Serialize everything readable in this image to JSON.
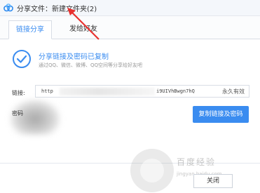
{
  "window": {
    "title": "分享文件：新建文件夹(2)",
    "app_icon": "baidu-netdisk-cloud-icon"
  },
  "tabs": [
    {
      "label": "链接分享",
      "active": true
    },
    {
      "label": "发给好友",
      "active": false
    }
  ],
  "status": {
    "title": "分享链接及密码已复制",
    "subtitle": "通过QQ、微信、微博、QQ空间等分享给好友吧",
    "icon": "check-circle-icon",
    "accent": "#3a8cf0"
  },
  "link": {
    "label": "链接:",
    "value_start": "http",
    "value_end": "i9UIVhBwgn7hQ",
    "expiry": "永久有效"
  },
  "password": {
    "label": "密码"
  },
  "buttons": {
    "copy": "复制链接及密码",
    "close": "关闭"
  },
  "watermark": {
    "text": "百度经验",
    "sub": "jingyan.baidu.com"
  },
  "annotation": {
    "color": "#e8312f"
  }
}
